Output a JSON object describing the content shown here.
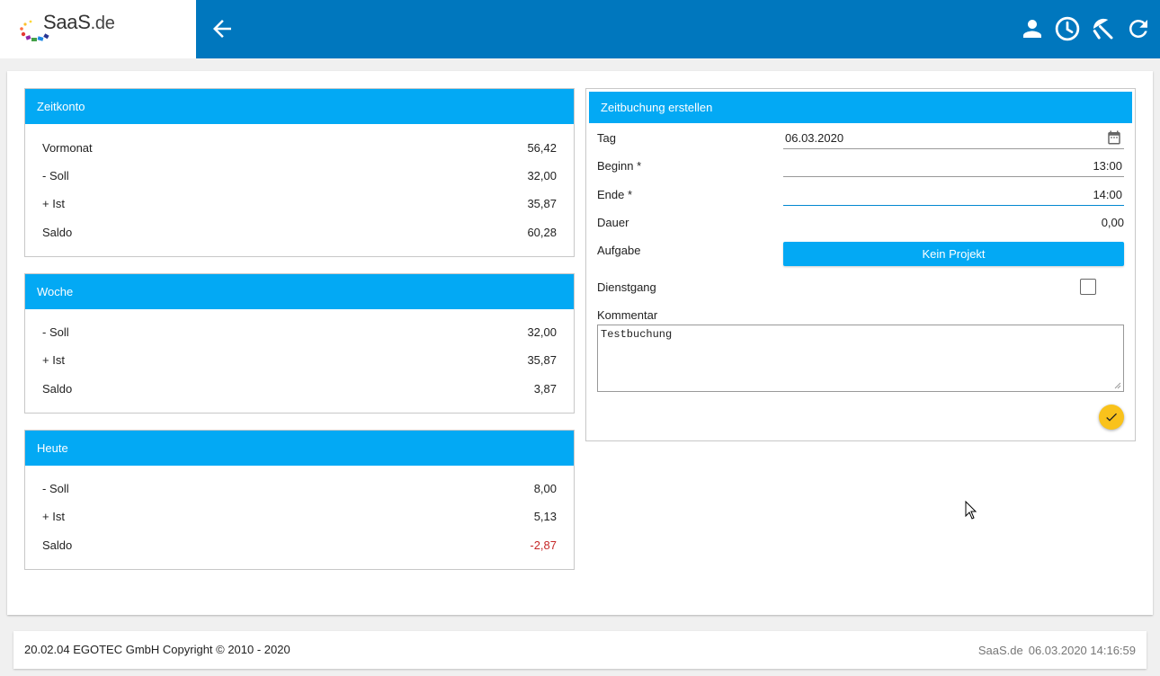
{
  "app": {
    "logo_text": "SaaS",
    "logo_tld": ".de"
  },
  "zeitkonto": {
    "title": "Zeitkonto",
    "rows": [
      {
        "label": "Vormonat",
        "value": "56,42"
      },
      {
        "label": "- Soll",
        "value": "32,00"
      },
      {
        "label": "+ Ist",
        "value": "35,87"
      },
      {
        "label": "Saldo",
        "value": "60,28"
      }
    ]
  },
  "woche": {
    "title": "Woche",
    "rows": [
      {
        "label": "- Soll",
        "value": "32,00"
      },
      {
        "label": "+ Ist",
        "value": "35,87"
      },
      {
        "label": "Saldo",
        "value": "3,87"
      }
    ]
  },
  "heute": {
    "title": "Heute",
    "rows": [
      {
        "label": "- Soll",
        "value": "8,00"
      },
      {
        "label": "+ Ist",
        "value": "5,13"
      },
      {
        "label": "Saldo",
        "value": "-2,87"
      }
    ]
  },
  "booking": {
    "title": "Zeitbuchung erstellen",
    "tag_label": "Tag",
    "tag_value": "06.03.2020",
    "beginn_label": "Beginn *",
    "beginn_value": "13:00",
    "ende_label": "Ende *",
    "ende_value": "14:00",
    "dauer_label": "Dauer",
    "dauer_value": "0,00",
    "aufgabe_label": "Aufgabe",
    "aufgabe_button": "Kein Projekt",
    "dienstgang_label": "Dienstgang",
    "kommentar_label": "Kommentar",
    "kommentar_value": "Testbuchung"
  },
  "footer": {
    "left": "20.02.04 EGOTEC GmbH Copyright © 2010 - 2020",
    "brand": "SaaS.de",
    "timestamp": "06.03.2020 14:16:59"
  },
  "colors": {
    "topbar": "#0077be",
    "card_header": "#03a9f4",
    "submit": "#f9c21b",
    "negative": "#c62828"
  },
  "icons": [
    "back-arrow-icon",
    "user-icon",
    "clock-icon",
    "vacation-icon",
    "refresh-icon",
    "calendar-icon",
    "checkmark-icon"
  ]
}
